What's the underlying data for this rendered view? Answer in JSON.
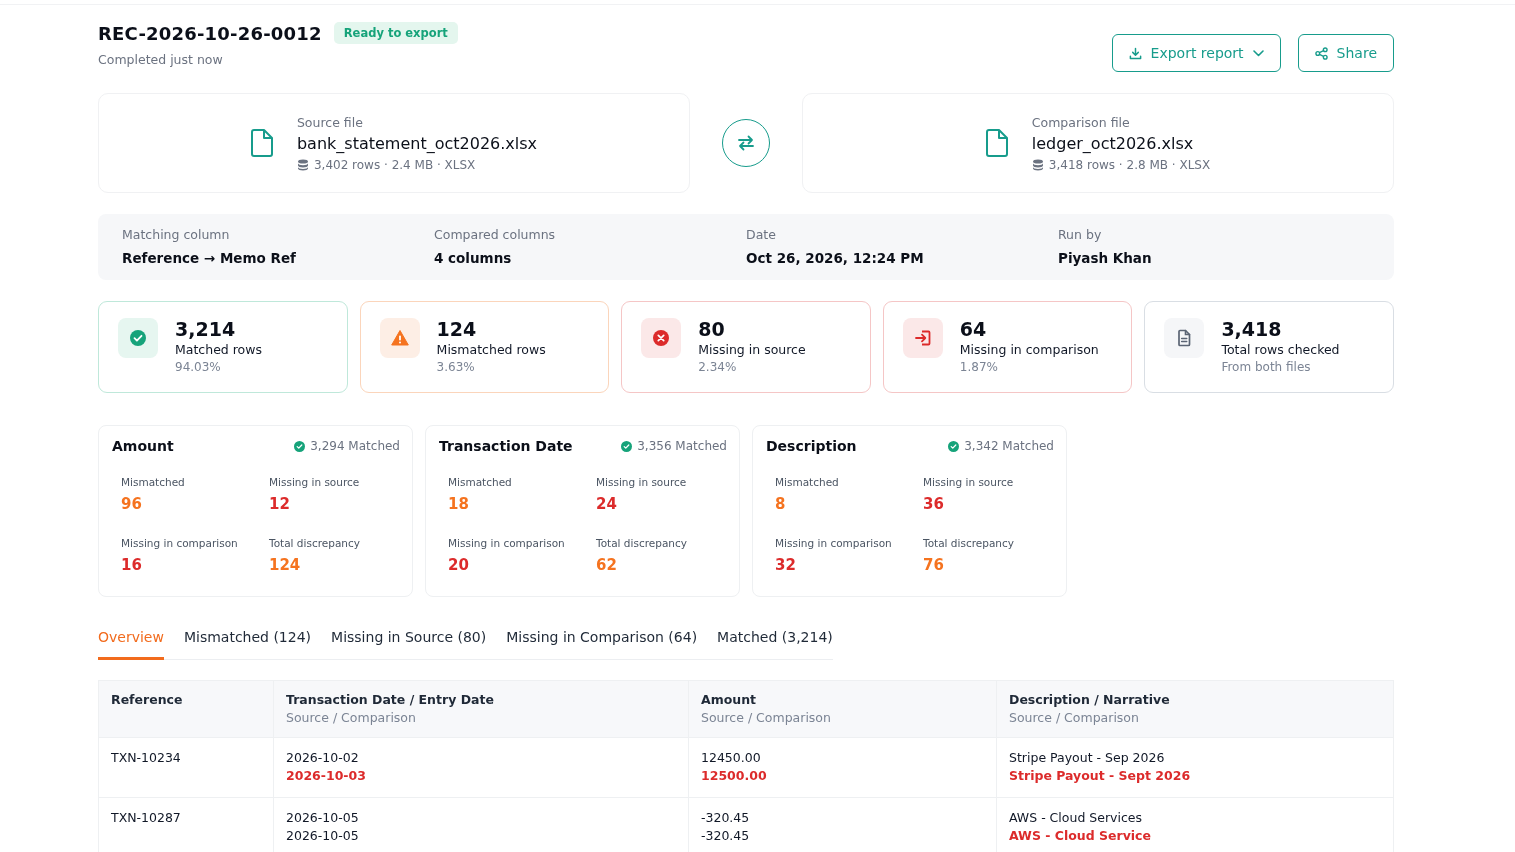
{
  "report": {
    "title": "REC-2026-10-26-0012",
    "badge": "Ready to export",
    "subtitle": "Completed just now"
  },
  "actions": [
    {
      "kind": "export",
      "label": "Export report"
    },
    {
      "kind": "share",
      "label": "Share"
    }
  ],
  "files": [
    {
      "label": "Source file",
      "name": "bank_statement_oct2026.xlsx",
      "meta": "3,402 rows · 2.4 MB · XLSX"
    },
    {
      "label": "Comparison file",
      "name": "ledger_oct2026.xlsx",
      "meta": "3,418 rows · 2.8 MB · XLSX"
    }
  ],
  "details": [
    {
      "label": "Matching column",
      "value": "Reference → Memo Ref"
    },
    {
      "label": "Compared columns",
      "value": "4 columns"
    },
    {
      "label": "Date",
      "value": "Oct 26, 2026, 12:24 PM"
    },
    {
      "label": "Run by",
      "value": "Piyash Khan"
    }
  ],
  "stats": [
    {
      "kind": "matched",
      "value": "3,214",
      "label": "Matched rows",
      "note": "94.03%"
    },
    {
      "kind": "mismatched",
      "value": "124",
      "label": "Mismatched rows",
      "note": "3.63%"
    },
    {
      "kind": "missing_source",
      "value": "80",
      "label": "Missing in source",
      "note": "2.34%"
    },
    {
      "kind": "missing_comparison",
      "value": "64",
      "label": "Missing in comparison",
      "note": "1.87%"
    },
    {
      "kind": "total",
      "value": "3,418",
      "label": "Total rows checked",
      "note": "From both files"
    }
  ],
  "columns": [
    {
      "name": "Amount",
      "matched": "3,294 Matched",
      "metrics": [
        {
          "label": "Mismatched",
          "value": "96",
          "color": "#f5731f"
        },
        {
          "label": "Missing in source",
          "value": "12",
          "color": "#dc2b2b"
        },
        {
          "label": "Missing in comparison",
          "value": "16",
          "color": "#dc2b2b"
        },
        {
          "label": "Total discrepancy",
          "value": "124",
          "color": "#f5731f"
        }
      ]
    },
    {
      "name": "Transaction Date",
      "matched": "3,356 Matched",
      "metrics": [
        {
          "label": "Mismatched",
          "value": "18",
          "color": "#f5731f"
        },
        {
          "label": "Missing in source",
          "value": "24",
          "color": "#dc2b2b"
        },
        {
          "label": "Missing in comparison",
          "value": "20",
          "color": "#dc2b2b"
        },
        {
          "label": "Total discrepancy",
          "value": "62",
          "color": "#f5731f"
        }
      ]
    },
    {
      "name": "Description",
      "matched": "3,342 Matched",
      "metrics": [
        {
          "label": "Mismatched",
          "value": "8",
          "color": "#f5731f"
        },
        {
          "label": "Missing in source",
          "value": "36",
          "color": "#dc2b2b"
        },
        {
          "label": "Missing in comparison",
          "value": "32",
          "color": "#dc2b2b"
        },
        {
          "label": "Total discrepancy",
          "value": "76",
          "color": "#f5731f"
        }
      ]
    }
  ],
  "tabs": [
    {
      "label": "Overview",
      "selected": true
    },
    {
      "label": "Mismatched (124)",
      "selected": false
    },
    {
      "label": "Missing in Source (80)",
      "selected": false
    },
    {
      "label": "Missing in Comparison (64)",
      "selected": false
    },
    {
      "label": "Matched (3,214)",
      "selected": false
    }
  ],
  "table": {
    "columns": [
      {
        "title": "Reference"
      },
      {
        "title": "Transaction Date / Entry Date",
        "subtitle": "Source / Comparison"
      },
      {
        "title": "Amount",
        "subtitle": "Source / Comparison"
      },
      {
        "title": "Description / Narrative",
        "subtitle": "Source / Comparison"
      }
    ],
    "rows": [
      {
        "cells": [
          {
            "kind": "reference",
            "text": "TXN-10234"
          },
          {
            "kind": "compare",
            "source": "2026-10-02",
            "comparison": "2026-10-03",
            "mismatch": true
          },
          {
            "kind": "compare",
            "source": "12450.00",
            "comparison": "12500.00",
            "mismatch": true
          },
          {
            "kind": "compare",
            "source": "Stripe Payout - Sep 2026",
            "comparison": "Stripe Payout - Sept 2026",
            "mismatch": true
          }
        ]
      },
      {
        "cells": [
          {
            "kind": "reference",
            "text": "TXN-10287"
          },
          {
            "kind": "compare",
            "source": "2026-10-05",
            "comparison": "2026-10-05",
            "mismatch": false
          },
          {
            "kind": "compare",
            "source": "-320.45",
            "comparison": "-320.45",
            "mismatch": false
          },
          {
            "kind": "compare",
            "source": "AWS - Cloud Services",
            "comparison": "AWS - Cloud Service",
            "mismatch": true
          }
        ]
      }
    ]
  }
}
